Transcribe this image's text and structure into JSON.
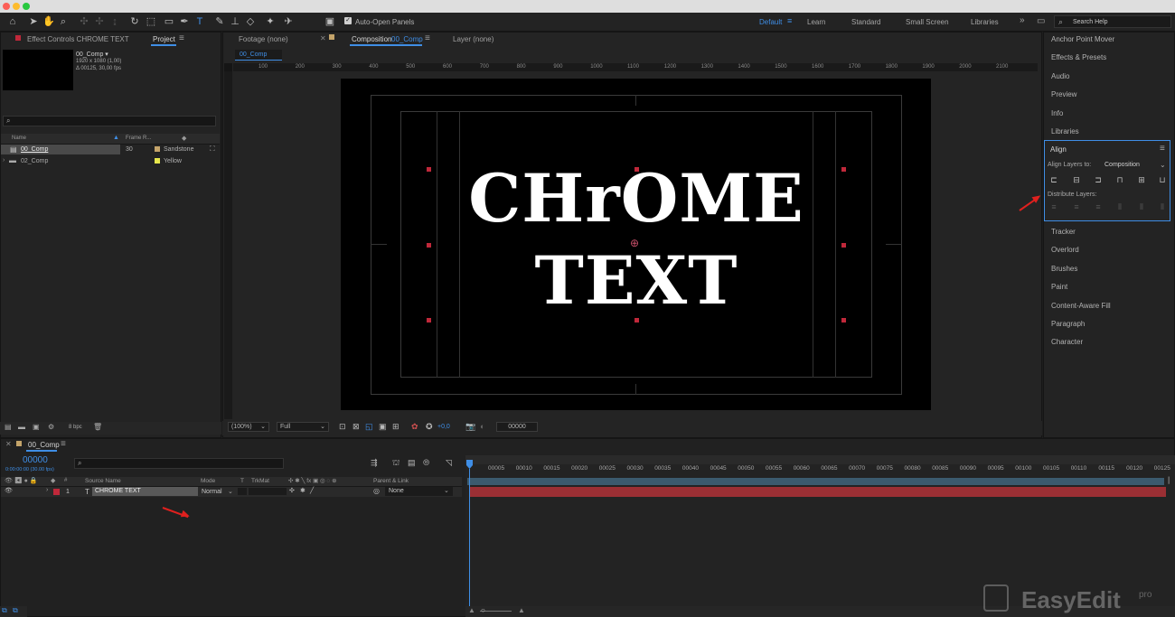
{
  "toolbar": {
    "auto_open_panels": "Auto-Open Panels",
    "workspaces": [
      "Default",
      "Learn",
      "Standard",
      "Small Screen",
      "Libraries"
    ],
    "search_help": "Search Help"
  },
  "project": {
    "effect_controls_tab": "Effect Controls CHROME TEXT",
    "project_tab": "Project",
    "thumb_name": "00_Comp ▾",
    "thumb_res": "1920 x 1080 (1,00)",
    "thumb_dur": "Δ 00125, 30,00 fps",
    "col_name": "Name",
    "col_frame_rate": "Frame R...",
    "items": [
      {
        "name": "00_Comp",
        "rate": "30",
        "label": "Sandstone",
        "color": "#c4a46a"
      },
      {
        "name": "02_Comp",
        "rate": "",
        "label": "Yellow",
        "color": "#e6e64c"
      }
    ],
    "bpc": "8 bpc"
  },
  "viewer": {
    "footage_tab": "Footage (none)",
    "comp_tab_prefix": "Composition",
    "comp_tab_name": "00_Comp",
    "layer_tab": "Layer (none)",
    "breadcrumb": "00_Comp",
    "title_line1": "CHrOME",
    "title_line2": "TEXT",
    "zoom": "(100%)",
    "resolution": "Full",
    "exposure": "+0,0",
    "timecode": "00000",
    "ruler_ticks": [
      "100",
      "200",
      "300",
      "400",
      "500",
      "600",
      "700",
      "800",
      "900",
      "1000",
      "1100",
      "1200",
      "1300",
      "1400",
      "1500",
      "1600",
      "1700",
      "1800",
      "1900",
      "2000",
      "2100"
    ]
  },
  "right_panel": {
    "items_top": [
      "Anchor Point Mover",
      "Effects & Presets",
      "Audio",
      "Preview",
      "Info",
      "Libraries"
    ],
    "align_title": "Align",
    "align_layers_to": "Align Layers to:",
    "align_target": "Composition",
    "distribute_layers": "Distribute Layers:",
    "items_bottom": [
      "Tracker",
      "Overlord",
      "Brushes",
      "Paint",
      "Content-Aware Fill",
      "Paragraph",
      "Character"
    ]
  },
  "timeline": {
    "comp_tab": "00_Comp",
    "current_time": "00000",
    "current_time_sub": "0:00:00:00 (30.00 fps)",
    "col_source_name": "Source Name",
    "col_mode": "Mode",
    "col_t": "T",
    "col_trkmat": "TrkMat",
    "col_parent": "Parent & Link",
    "layer": {
      "index": "1",
      "type": "T",
      "name": "CHROME TEXT",
      "mode": "Normal",
      "parent": "None"
    },
    "frames": [
      "00005",
      "00010",
      "00015",
      "00020",
      "00025",
      "00030",
      "00035",
      "00040",
      "00045",
      "00050",
      "00055",
      "00060",
      "00065",
      "00070",
      "00075",
      "00080",
      "00085",
      "00090",
      "00095",
      "00100",
      "00105",
      "00110",
      "00115",
      "00120",
      "00125"
    ]
  },
  "watermark": {
    "brand": "EasyEdit",
    "suffix": "pro"
  },
  "colors": {
    "accent": "#3f8ee6",
    "layer_bar": "#9b2f34",
    "handle": "#c0283a",
    "annotation_arrow": "#e0201e"
  }
}
